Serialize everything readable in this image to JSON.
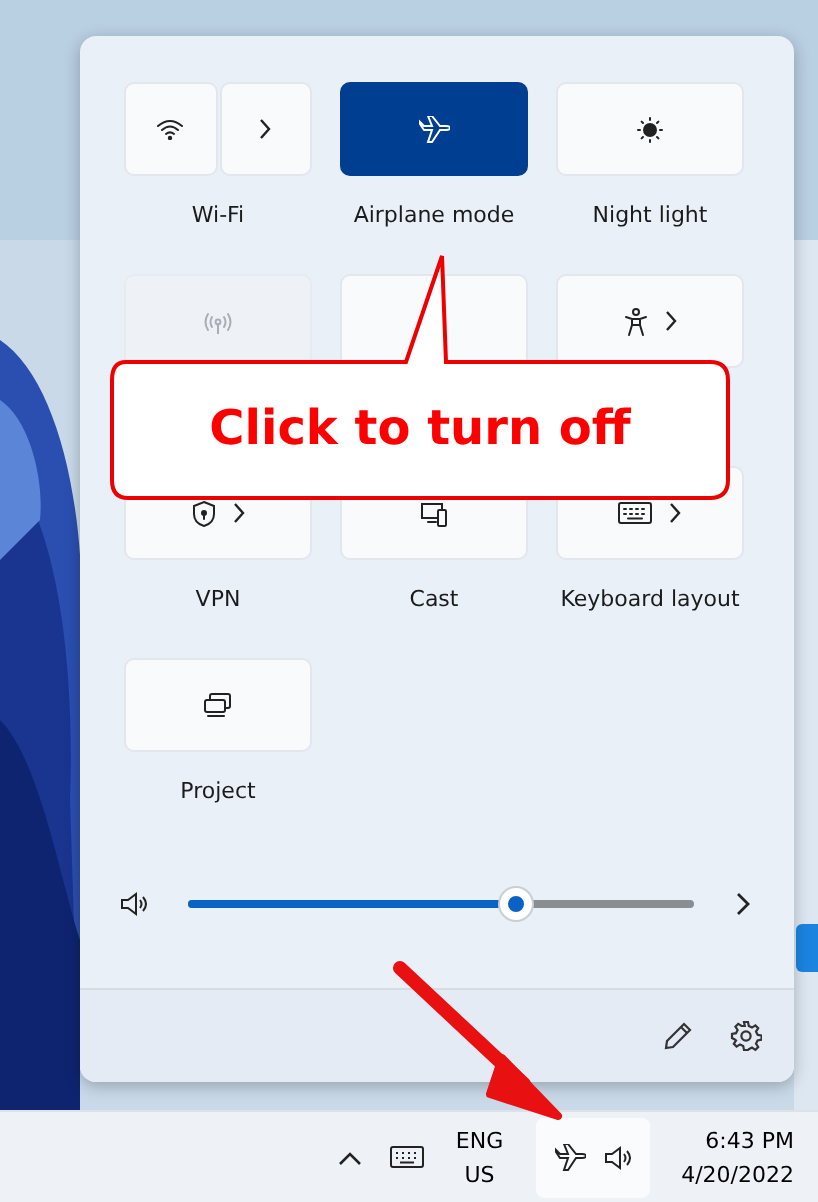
{
  "quick_settings": {
    "tiles": [
      {
        "kind": "split",
        "label": "Wi-Fi",
        "selected": false,
        "disabled": false,
        "expandable": true
      },
      {
        "kind": "plain",
        "label": "Airplane mode",
        "selected": true,
        "disabled": false,
        "expandable": false
      },
      {
        "kind": "plain",
        "label": "Night light",
        "selected": false,
        "disabled": false,
        "expandable": false
      },
      {
        "kind": "plain",
        "selected": false,
        "disabled": true,
        "expandable": false
      },
      {
        "kind": "hidden",
        "selected": false
      },
      {
        "kind": "plain",
        "selected": false,
        "disabled": false,
        "expandable": true
      },
      {
        "kind": "plain",
        "label": "VPN",
        "selected": false,
        "disabled": false,
        "expandable": true
      },
      {
        "kind": "plain",
        "label": "Cast",
        "selected": false,
        "disabled": false,
        "expandable": false
      },
      {
        "kind": "plain",
        "label": "Keyboard layout",
        "selected": false,
        "disabled": false,
        "expandable": true
      },
      {
        "kind": "plain",
        "label": "Project",
        "selected": false,
        "disabled": false,
        "expandable": false
      }
    ],
    "volume": {
      "level": 0.65
    }
  },
  "callout": {
    "text": "Click to turn off"
  },
  "taskbar": {
    "language": "ENG",
    "region": "US",
    "time": "6:43 PM",
    "date": "4/20/2022"
  }
}
